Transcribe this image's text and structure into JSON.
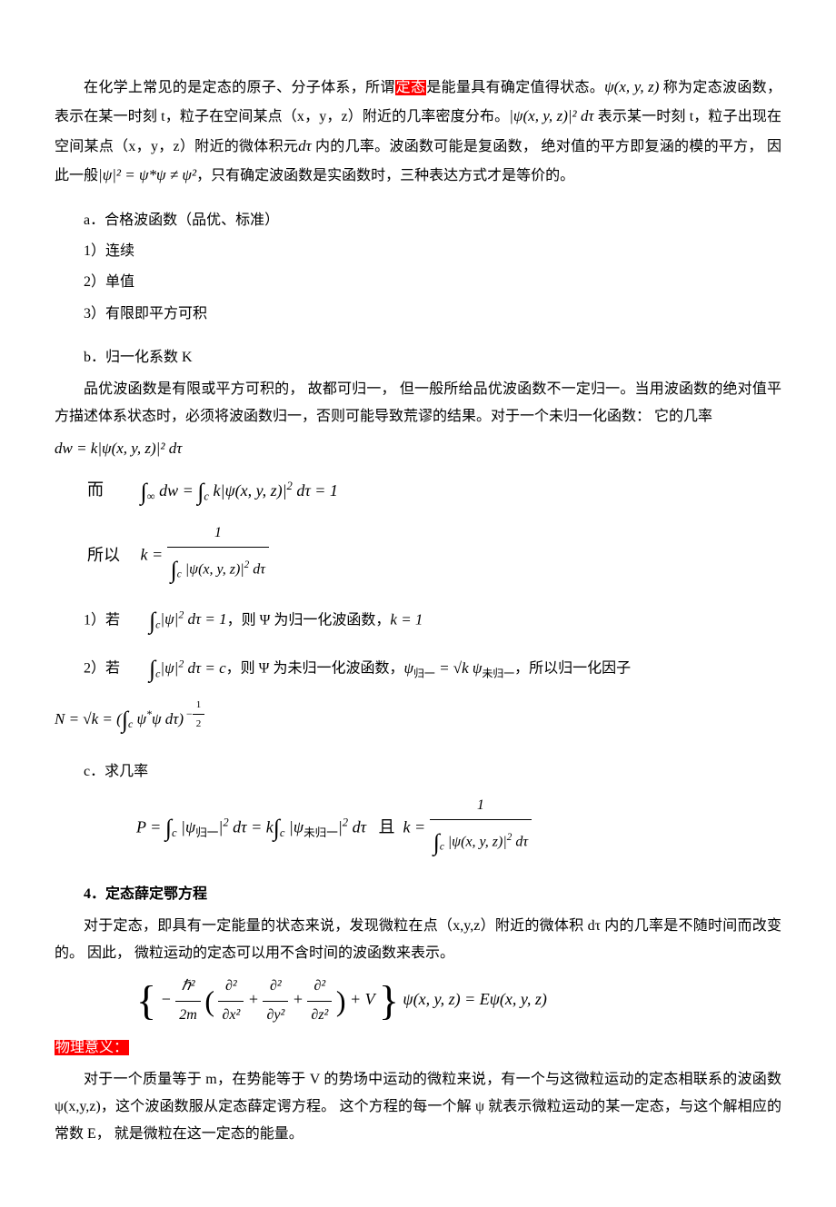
{
  "para1": {
    "t1": "在化学上常见的是定态的原子、分子体系，所谓",
    "hl1": "定态",
    "t2": "是能量具有确定值得状态。",
    "f1": "ψ(x, y, z)",
    "t3": " 称为定态波函数，表示在某一时刻 t，粒子在空间某点（x，y，z）附近的几率密度分布。",
    "f2": "|ψ(x, y, z)|² dτ",
    "t4": " 表示某一时刻 t，粒子出现在空间某点（x，y，z）附近的微体积元",
    "f3": "dτ",
    "t5": " 内的几率。波函数可能是复函数，  绝对值的平方即复涵的模的平方，  因此一般",
    "f4": "|ψ|² = ψ*ψ ≠ ψ²",
    "t6": "，只有确定波函数是实函数时，三种表达方式才是等价的。"
  },
  "secA": {
    "title": "a．合格波函数（品优、标准）",
    "i1": "1）连续",
    "i2": "2）单值",
    "i3": "3）有限即平方可积"
  },
  "secB": {
    "title": "b．归一化系数 K",
    "p1": "品优波函数是有限或平方可积的，  故都可归一，  但一般所给品优波函数不一定归一。当用波函数的绝对值平方描述体系状态时，必须将波函数归一，否则可能导致荒谬的结果。对于一个未归一化函数：  它的几率",
    "eq_dw": "dw = k|ψ(x, y, z)|² dτ",
    "label_er": "而",
    "eq_int": "∫∞ dw = ∫c k|ψ(x, y, z)|² dτ = 1",
    "label_so": "所以",
    "k_eq": "k = ",
    "k_num": "1",
    "k_den": "∫c |ψ(x, y, z)|² dτ",
    "i1a": "1）若",
    "i1f": "∫c |ψ|² dτ = 1",
    "i1b": "，则 Ψ 为归一化波函数，",
    "i1f2": "k = 1",
    "i2a": "2）若",
    "i2f": "∫c |ψ|² dτ = c",
    "i2b": "，则 Ψ 为未归一化波函数，",
    "i2f2": "ψ归一 = √k ψ未归一",
    "i2c": "，所以归一化因子",
    "eqN": "N = √k = (∫c ψ*ψ dτ)",
    "eqN_exp": "−½"
  },
  "secC": {
    "title": "c．求几率",
    "P_eq": "P = ∫c |ψ归一|² dτ = k∫c |ψ未归一|² dτ",
    "label_qie": "且",
    "k2_eq": "k = ",
    "k2_num": "1",
    "k2_den": "∫c |ψ(x, y, z)|² dτ"
  },
  "sec4": {
    "title": "4．定态薛定鄂方程",
    "p1": "对于定态，即具有一定能量的状态来说，发现微粒在点（x,y,z）附近的微体积 dτ 内的几率是不随时间而改变的。  因此，  微粒运动的定态可以用不含时间的波函数来表示。",
    "eq_pre": "− ",
    "eq_h2": "ℏ²",
    "eq_2m": "2m",
    "eq_d2x": "∂²",
    "eq_dx2": "∂x²",
    "eq_d2y": "∂²",
    "eq_dy2": "∂y²",
    "eq_d2z": "∂²",
    "eq_dz2": "∂z²",
    "eq_plusV": " + V",
    "eq_psi": "ψ(x, y, z) = Eψ(x, y, z)",
    "hl": "物理意义：",
    "p2": "对于一个质量等于 m，在势能等于 V 的势场中运动的微粒来说，有一个与这微粒运动的定态相联系的波函数 ψ(x,y,z)，这个波函数服从定态薛定谔方程。  这个方程的每一个解 ψ 就表示微粒运动的某一定态，与这个解相应的常数 E，  就是微粒在这一定态的能量。"
  }
}
